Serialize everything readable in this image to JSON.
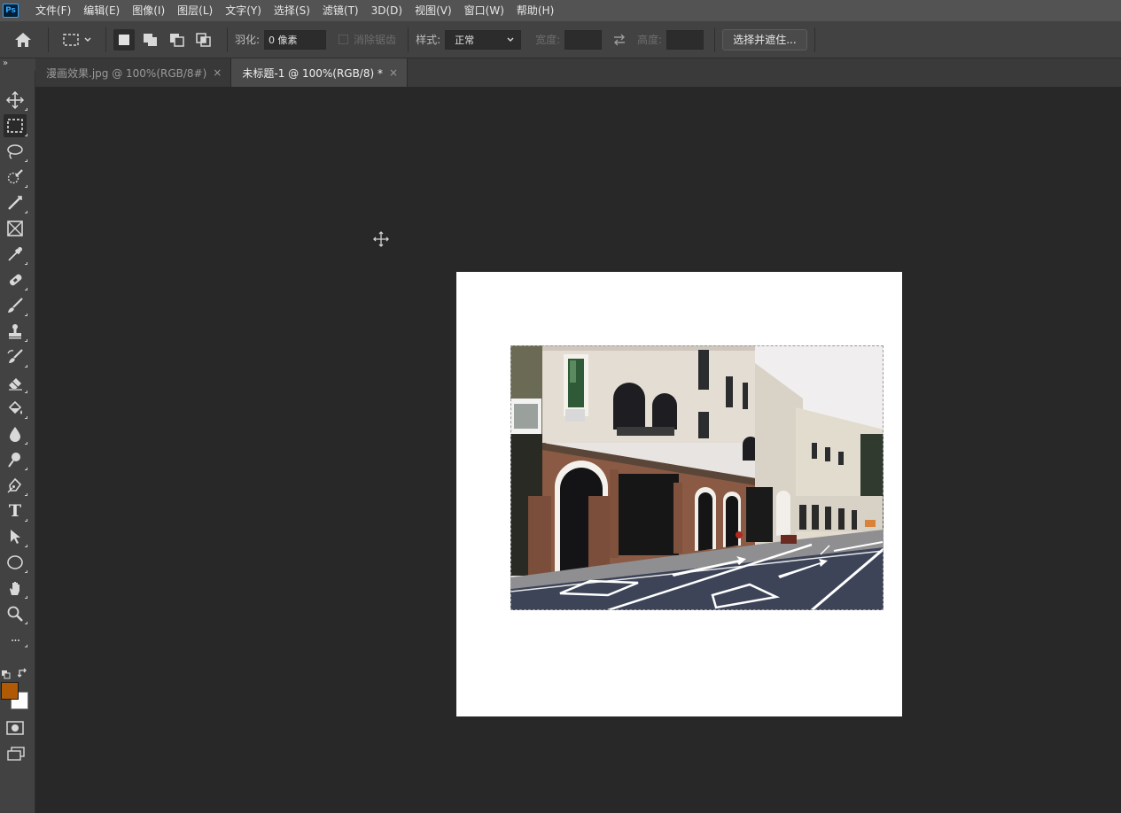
{
  "app": {
    "logo": "Ps"
  },
  "menu": [
    "文件(F)",
    "编辑(E)",
    "图像(I)",
    "图层(L)",
    "文字(Y)",
    "选择(S)",
    "滤镜(T)",
    "3D(D)",
    "视图(V)",
    "窗口(W)",
    "帮助(H)"
  ],
  "options": {
    "feather_label": "羽化:",
    "feather_value": "0 像素",
    "antialias_label": "消除锯齿",
    "style_label": "样式:",
    "style_value": "正常",
    "width_label": "宽度:",
    "height_label": "高度:",
    "select_mask_button": "选择并遮住..."
  },
  "tabs": [
    {
      "label": "漫画效果.jpg @ 100%(RGB/8#)",
      "close": "×",
      "active": false
    },
    {
      "label": "未标题-1 @ 100%(RGB/8) *",
      "close": "×",
      "active": true
    }
  ],
  "toolbar_collapse": "»",
  "tools": [
    "move-tool-icon",
    "rectangular-marquee-tool-icon",
    "lasso-tool-icon",
    "quick-selection-tool-icon",
    "crop-tool-icon",
    "frame-tool-icon",
    "eyedropper-tool-icon",
    "healing-brush-tool-icon",
    "brush-tool-icon",
    "clone-stamp-tool-icon",
    "history-brush-tool-icon",
    "eraser-tool-icon",
    "paint-bucket-tool-icon",
    "blur-tool-icon",
    "dodge-tool-icon",
    "pen-tool-icon",
    "type-tool-icon",
    "path-selection-tool-icon",
    "ellipse-tool-icon",
    "hand-tool-icon",
    "zoom-tool-icon",
    "more-tools-icon"
  ],
  "type_tool_glyph": "T",
  "more_tools_glyph": "···",
  "colors": {
    "foreground": "#b05a05",
    "background": "#ffffff",
    "accent": "#31a8ff",
    "workspace": "#282828",
    "panel": "#424242"
  }
}
